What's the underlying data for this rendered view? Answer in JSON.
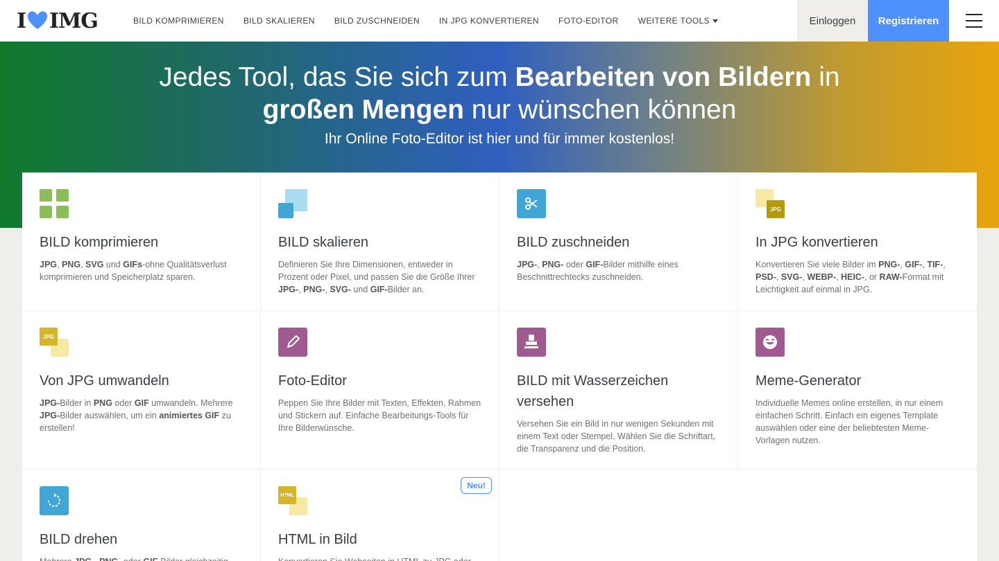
{
  "header": {
    "logo_left": "I",
    "logo_right": "IMG",
    "nav": [
      {
        "label": "BILD KOMPRIMIEREN"
      },
      {
        "label": "BILD SKALIEREN"
      },
      {
        "label": "BILD ZUSCHNEIDEN"
      },
      {
        "label": "IN JPG KONVERTIEREN"
      },
      {
        "label": "FOTO-EDITOR"
      },
      {
        "label": "WEITERE TOOLS"
      }
    ],
    "login_label": "Einloggen",
    "register_label": "Registrieren"
  },
  "hero": {
    "title_part1": "Jedes Tool, das Sie sich zum ",
    "title_bold1": "Bearbeiten von Bildern",
    "title_part2": " in",
    "title_bold2": "großen Mengen",
    "title_part3": " nur wünschen können",
    "subtitle": "Ihr Online Foto-Editor ist hier und für immer kostenlos!"
  },
  "tools": [
    {
      "title": "BILD komprimieren",
      "icon": "compress-icon"
    },
    {
      "title": "BILD skalieren",
      "icon": "resize-icon"
    },
    {
      "title": "BILD zuschneiden",
      "icon": "crop-icon"
    },
    {
      "title": "In JPG konvertieren",
      "icon": "to-jpg-icon"
    },
    {
      "title": "Von JPG umwandeln",
      "icon": "from-jpg-icon"
    },
    {
      "title": "Foto-Editor",
      "icon": "pencil-icon"
    },
    {
      "title": "BILD mit Wasserzeichen versehen",
      "icon": "stamp-icon"
    },
    {
      "title": "Meme-Generator",
      "icon": "meme-icon"
    },
    {
      "title": "BILD drehen",
      "icon": "rotate-icon"
    },
    {
      "title": "HTML in Bild",
      "icon": "html-icon",
      "badge": "Neu!"
    }
  ],
  "icon_labels": {
    "jpg": "JPG",
    "html": "HTML"
  },
  "colors": {
    "brand_blue": "#4d90fe",
    "green": "#8cbd5b",
    "purple": "#9f5b8f",
    "yellow": "#d7b52b"
  }
}
